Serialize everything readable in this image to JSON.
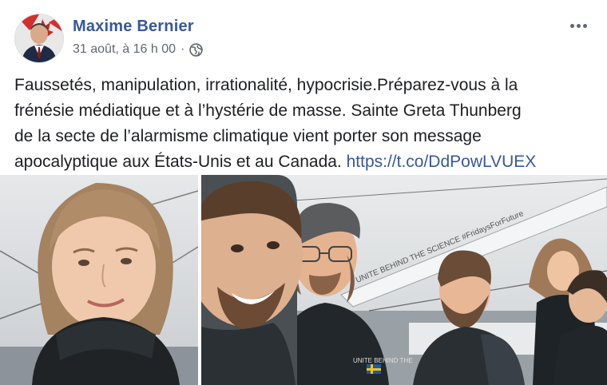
{
  "post": {
    "author": "Maxime Bernier",
    "timestamp": "31 août, à 16 h 00",
    "separator": "·",
    "privacy_icon": "globe-icon",
    "more_icon": "more-options-icon",
    "text_lines": [
      "Faussetés, manipulation, irrationalité, hypocrisie.Préparez-vous à la",
      "frénésie médiatique et à l’hystérie de masse. Sainte Greta Thunberg",
      "de la secte de l’alarmisme climatique vient porter son message",
      "apocalyptique aux États-Unis et au Canada. "
    ],
    "link": "https://t.co/DdPowLVUEX"
  },
  "photo_right": {
    "boom_text": "UNITE BEHIND THE SCIENCE #FridaysForFuture",
    "jacket_text": "UNITE BEHIND THE"
  },
  "colors": {
    "author_link": "#385898",
    "meta_gray": "#606770",
    "body_text": "#1c1e21"
  }
}
